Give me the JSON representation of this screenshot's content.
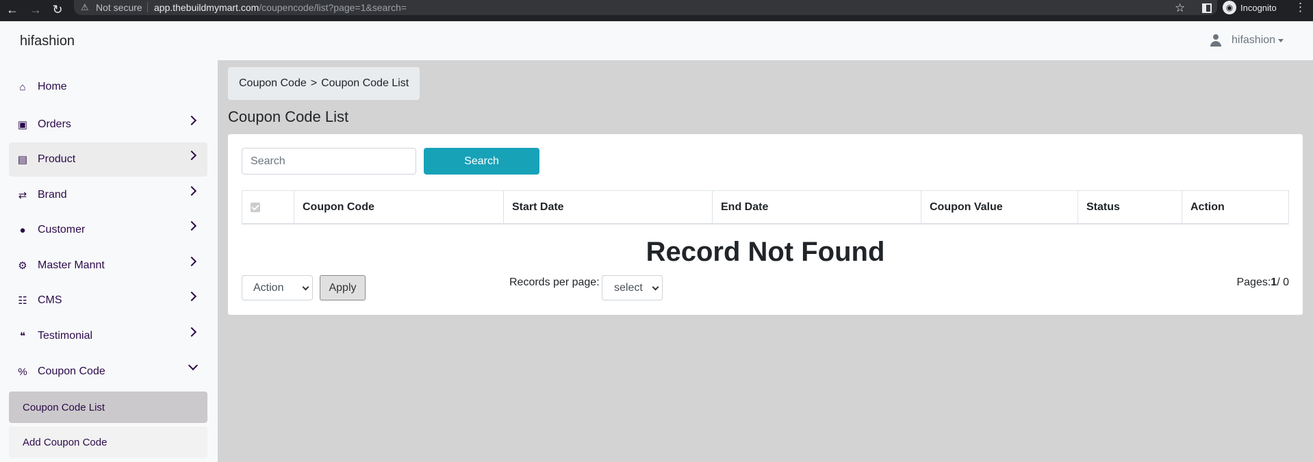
{
  "browser": {
    "security": "Not secure",
    "url_domain": "app.thebuildmymart.com",
    "url_path": "/coupencode/list?page=1&search=",
    "profile": "Incognito"
  },
  "app": {
    "brand": "hifashion",
    "user": "hifashion"
  },
  "sidebar": {
    "items": [
      {
        "label": "Home",
        "icon": "home-icon"
      },
      {
        "label": "Orders",
        "icon": "bag-icon"
      },
      {
        "label": "Product",
        "icon": "archive-icon"
      },
      {
        "label": "Brand",
        "icon": "shuffle-icon"
      },
      {
        "label": "Customer",
        "icon": "user-icon"
      },
      {
        "label": "Master Mannt",
        "icon": "user-cog-icon"
      },
      {
        "label": "CMS",
        "icon": "file-icon"
      },
      {
        "label": "Testimonial",
        "icon": "quote-icon"
      },
      {
        "label": "Coupon Code",
        "icon": "percent-icon"
      }
    ],
    "sub_items": [
      {
        "label": "Coupon Code List"
      },
      {
        "label": "Add Coupon Code"
      }
    ]
  },
  "main": {
    "breadcrumb": {
      "parent": "Coupon Code",
      "separator": ">",
      "current": "Coupon Code List"
    },
    "title": "Coupon Code List",
    "search": {
      "placeholder": "Search",
      "button": "Search"
    },
    "table": {
      "columns": [
        "Coupon Code",
        "Start Date",
        "End Date",
        "Coupon Value",
        "Status",
        "Action"
      ]
    },
    "empty_message": "Record Not Found",
    "bulk": {
      "action_select": "Action",
      "apply": "Apply"
    },
    "records_per_page": {
      "label": "Records per page:",
      "value": "select"
    },
    "pages": {
      "label": "Pages:",
      "current": "1",
      "total": "/ 0"
    }
  },
  "colors": {
    "accent": "#17a2b8",
    "sidebar_text": "#2b0a4a",
    "background": "#d3d3d3"
  }
}
